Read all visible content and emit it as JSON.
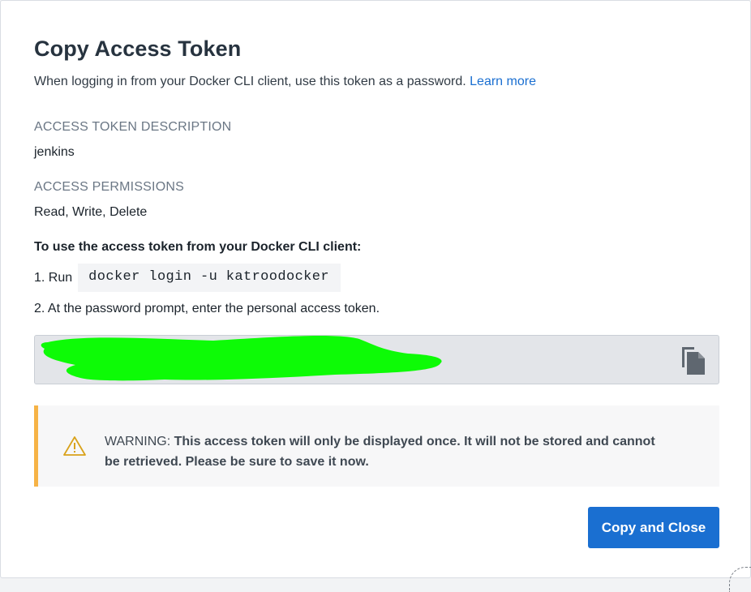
{
  "dialog": {
    "title": "Copy Access Token",
    "subtitle": "When logging in from your Docker CLI client, use this token as a password.",
    "learn_more_label": "Learn more"
  },
  "token_description": {
    "label": "ACCESS TOKEN DESCRIPTION",
    "value": "jenkins"
  },
  "permissions": {
    "label": "ACCESS PERMISSIONS",
    "value": "Read, Write, Delete"
  },
  "instructions": {
    "heading": "To use the access token from your Docker CLI client:",
    "step1_prefix": "1. Run",
    "step1_command": "docker login -u katroodocker",
    "step2": "2. At the password prompt, enter the personal access token."
  },
  "token_field": {
    "redacted_color": "#00ff00",
    "copy_icon": "copy-icon"
  },
  "warning": {
    "prefix": "WARNING: ",
    "message": "This access token will only be displayed once. It will not be stored and cannot be retrieved. Please be sure to save it now.",
    "icon": "warning-triangle-icon",
    "accent_color": "#f6b346"
  },
  "actions": {
    "copy_and_close_label": "Copy and Close",
    "accent_color": "#1a6fd1"
  }
}
